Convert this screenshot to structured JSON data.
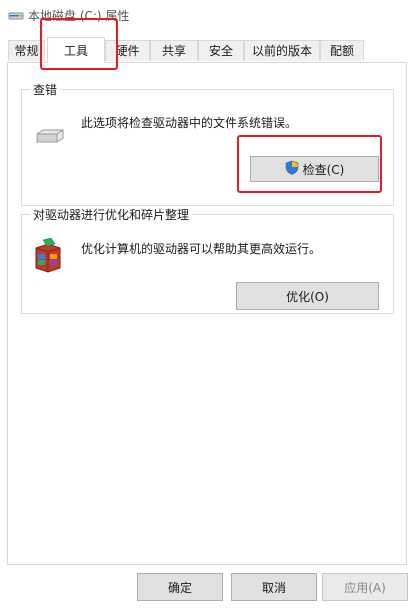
{
  "window": {
    "title": "本地磁盘 (C:) 属性",
    "title_icon": "drive-icon"
  },
  "tabs": [
    {
      "label": "常规",
      "active": false
    },
    {
      "label": "工具",
      "active": true
    },
    {
      "label": "硬件",
      "active": false
    },
    {
      "label": "共享",
      "active": false
    },
    {
      "label": "安全",
      "active": false
    },
    {
      "label": "以前的版本",
      "active": false
    },
    {
      "label": "配额",
      "active": false
    }
  ],
  "error_check": {
    "group_label": "查错",
    "description": "此选项将检查驱动器中的文件系统错误。",
    "icon": "drive-icon",
    "button_label": "检查(C)",
    "button_icon": "uac-shield-icon"
  },
  "optimize": {
    "group_label": "对驱动器进行优化和碎片整理",
    "description": "优化计算机的驱动器可以帮助其更高效运行。",
    "icon": "defrag-icon",
    "button_label": "优化(O)"
  },
  "footer": {
    "ok_label": "确定",
    "cancel_label": "取消",
    "apply_label": "应用(A)",
    "apply_enabled": false
  },
  "annotations": {
    "highlight_color": "#e51c23"
  }
}
